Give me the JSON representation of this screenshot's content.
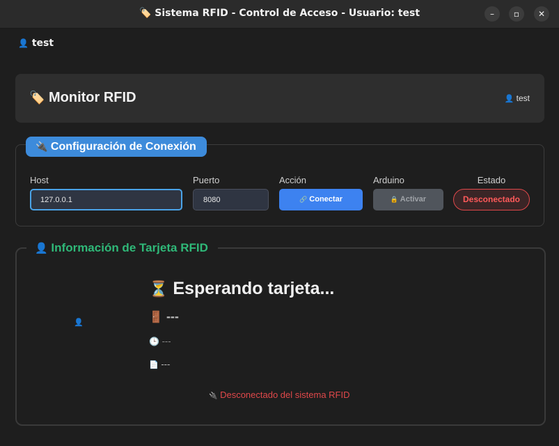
{
  "window": {
    "title": "🏷️ Sistema RFID - Control de Acceso - Usuario: test",
    "minimize": "–",
    "maximize": "▫",
    "close": "✕"
  },
  "user_top": {
    "icon": "👤",
    "name": "test"
  },
  "header": {
    "icon": "🏷️",
    "title": "Monitor RFID",
    "user_icon": "👤",
    "user": "test"
  },
  "connection": {
    "title_icon": "🔌",
    "title": "Configuración de Conexión",
    "host_label": "Host",
    "host_value": "127.0.0.1",
    "port_label": "Puerto",
    "port_value": "8080",
    "action_label": "Acción",
    "connect_icon": "🔗",
    "connect_button": "Conectar",
    "arduino_label": "Arduino",
    "activate_icon": "🔒",
    "activate_button": "Activar",
    "status_label": "Estado",
    "status_value": "Desconectado"
  },
  "card_info": {
    "title_icon": "👤",
    "title": "Información de Tarjeta RFID",
    "photo_icon": "👤",
    "waiting_icon": "⏳",
    "waiting_text": "Esperando tarjeta...",
    "door_icon": "🚪",
    "door_value": "---",
    "time_icon": "🕒",
    "time_value": "---",
    "doc_icon": "📄",
    "doc_value": "---",
    "status_icon": "🔌",
    "status_text": "Desconectado del sistema RFID"
  },
  "colors": {
    "accent": "#3d8bdb",
    "success": "#2fb878",
    "danger": "#e0484a"
  }
}
